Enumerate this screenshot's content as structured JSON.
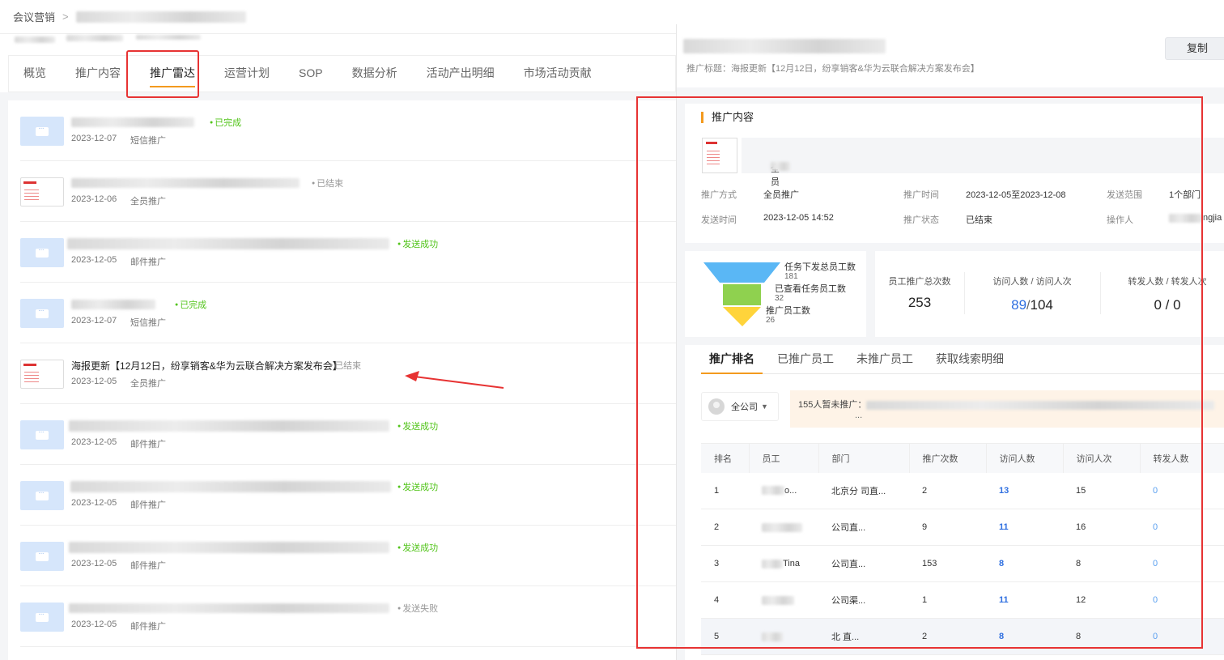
{
  "breadcrumb": {
    "root": "会议营销",
    "separator": ">"
  },
  "tabs": [
    "概览",
    "推广内容",
    "推广雷达",
    "运营计划",
    "SOP",
    "数据分析",
    "活动产出明细",
    "市场活动贡献"
  ],
  "active_tab_index": 2,
  "list": [
    {
      "title": "",
      "status": "已完成",
      "status_color": "green",
      "date": "2023-12-07",
      "type": "短信推广",
      "thumb": "message-icon"
    },
    {
      "title": "",
      "status": "已结束",
      "status_color": "grey",
      "date": "2023-12-06",
      "type": "全员推广",
      "thumb": "poster"
    },
    {
      "title": "",
      "status": "发送成功",
      "status_color": "green",
      "date": "2023-12-05",
      "type": "邮件推广",
      "thumb": "message-icon"
    },
    {
      "title": "",
      "status": "已完成",
      "status_color": "green",
      "date": "2023-12-07",
      "type": "短信推广",
      "thumb": "message-icon"
    },
    {
      "title": "海报更新【12月12日，纷享销客&华为云联合解决方案发布会】",
      "status": "已结束",
      "status_color": "grey",
      "date": "2023-12-05",
      "type": "全员推广",
      "thumb": "poster"
    },
    {
      "title": "",
      "status": "发送成功",
      "status_color": "green",
      "date": "2023-12-05",
      "type": "邮件推广",
      "thumb": "message-icon"
    },
    {
      "title": "",
      "status": "发送成功",
      "status_color": "green",
      "date": "2023-12-05",
      "type": "邮件推广",
      "thumb": "message-icon"
    },
    {
      "title": "",
      "status": "发送成功",
      "status_color": "green",
      "date": "2023-12-05",
      "type": "邮件推广",
      "thumb": "message-icon"
    },
    {
      "title": "",
      "status": "发送失败",
      "status_color": "grey",
      "date": "2023-12-05",
      "type": "邮件推广",
      "thumb": "message-icon"
    }
  ],
  "detail": {
    "promo_title": "推广标题：海报更新【12月12日，纷享销客&华为云联合解决方案发布会】",
    "copy_label": "复制",
    "content_section_title": "推广内容",
    "content_name": "全员",
    "fields": {
      "method_label": "推广方式",
      "method_value": "全员推广",
      "time_label": "推广时间",
      "time_value": "2023-12-05至2023-12-08",
      "scope_label": "发送范围",
      "scope_value": "1个部门",
      "send_time_label": "发送时间",
      "send_time_value": "2023-12-05 14:52",
      "status_label": "推广状态",
      "status_value": "已结束",
      "operator_label": "操作人",
      "operator_value": "ngjia"
    }
  },
  "funnel": {
    "stages": [
      {
        "label": "任务下发总员工数",
        "value": "181",
        "color": "#5ab7f5"
      },
      {
        "label": "已查看任务员工数",
        "value": "32",
        "color": "#8fd14f"
      },
      {
        "label": "推广员工数",
        "value": "26",
        "color": "#ffd43b"
      }
    ]
  },
  "stats": {
    "total_label": "员工推广总次数",
    "total_value": "253",
    "visit_label": "访问人数 / 访问人次",
    "visit_people": "89",
    "visit_sep": "/",
    "visit_times": "104",
    "forward_label": "转发人数 / 转发人次",
    "forward_value": "0 / 0"
  },
  "rank": {
    "tabs": [
      "推广排名",
      "已推广员工",
      "未推广员工",
      "获取线索明细"
    ],
    "org_select": "全公司",
    "notice": "155人暂未推广：",
    "notice_more": "...",
    "columns": [
      "排名",
      "员工",
      "部门",
      "推广次数",
      "访问人数",
      "访问人次",
      "转发人数"
    ],
    "rows": [
      {
        "rank": "1",
        "employee": "o...",
        "dept": "北京分  司直...",
        "count": "2",
        "visitors": "13",
        "visits": "15",
        "forwards": "0"
      },
      {
        "rank": "2",
        "employee": "",
        "dept": "公司直...",
        "count": "9",
        "visitors": "11",
        "visits": "16",
        "forwards": "0"
      },
      {
        "rank": "3",
        "employee": "Tina",
        "dept": "公司直...",
        "count": "153",
        "visitors": "8",
        "visits": "8",
        "forwards": "0"
      },
      {
        "rank": "4",
        "employee": "",
        "dept": "公司渠...",
        "count": "1",
        "visitors": "11",
        "visits": "12",
        "forwards": "0"
      },
      {
        "rank": "5",
        "employee": "",
        "dept": "北 直...",
        "count": "2",
        "visitors": "8",
        "visits": "8",
        "forwards": "0"
      }
    ]
  },
  "colors": {
    "accent": "#f39a1e",
    "highlight": "#e73333",
    "link": "#2f6fe0"
  }
}
